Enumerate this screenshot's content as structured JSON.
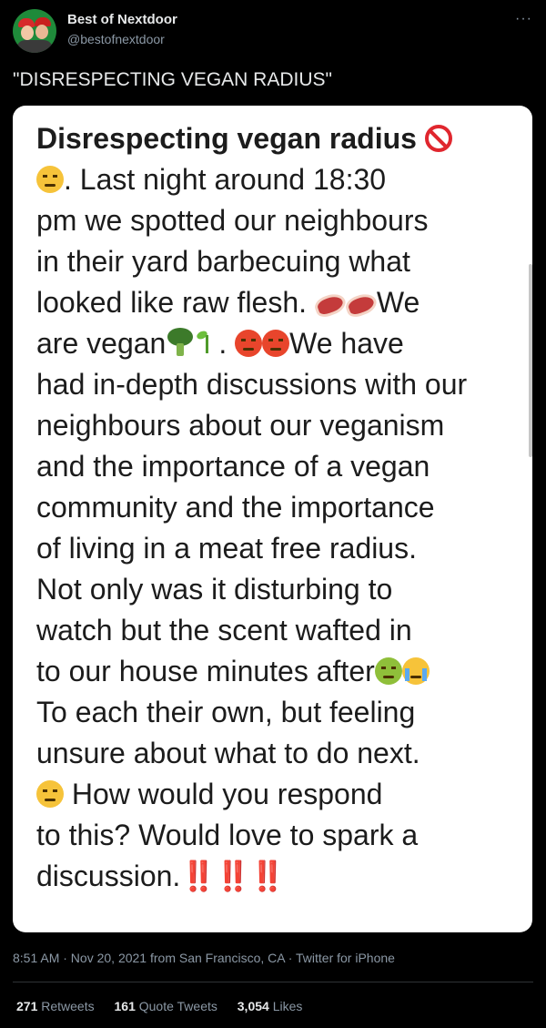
{
  "author": {
    "display_name": "Best of Nextdoor",
    "handle": "@bestofnextdoor"
  },
  "tweet": {
    "text": "\"DISRESPECTING VEGAN RADIUS\""
  },
  "post_image": {
    "title": "Disrespecting vegan radius",
    "lines": [
      ". Last night around 18:30",
      "pm we spotted our neighbours",
      "in their yard barbecuing what",
      "looked like raw flesh. ",
      "We",
      "are vegan",
      ". ",
      "We have",
      "had in-depth discussions with our",
      "neighbours about our veganism",
      "and the importance of a vegan",
      "community and the importance",
      "of living in a meat free radius.",
      "Not only was it disturbing to",
      "watch but the scent wafted in",
      "to our house minutes after",
      "To each their own, but feeling",
      "unsure about what to do next.",
      " How would you respond",
      "to this? Would love to spark a",
      "discussion.",
      "‼️‼️‼️"
    ],
    "emoji_names": [
      "prohibited-icon",
      "expressionless-face-icon",
      "cut-of-meat-icon",
      "broccoli-icon",
      "seedling-icon",
      "angry-face-icon",
      "nauseated-face-icon",
      "crying-face-icon",
      "unamused-face-icon",
      "double-exclamation-icon"
    ]
  },
  "meta": {
    "timestamp": "8:51 AM · Nov 20, 2021",
    "source_prefix": " from San Francisco, CA · Twitter for iPhone"
  },
  "stats": {
    "retweets_count": "271",
    "retweets_label": " Retweets",
    "quotes_count": "161",
    "quotes_label": " Quote Tweets",
    "likes_count": "3,054",
    "likes_label": " Likes"
  },
  "colors": {
    "background": "#000000",
    "text_primary": "#e7e9ea",
    "text_secondary": "#8b98a5",
    "card_background": "#ffffff",
    "card_text": "#1c1c1c",
    "accent_red": "#e0262e"
  }
}
